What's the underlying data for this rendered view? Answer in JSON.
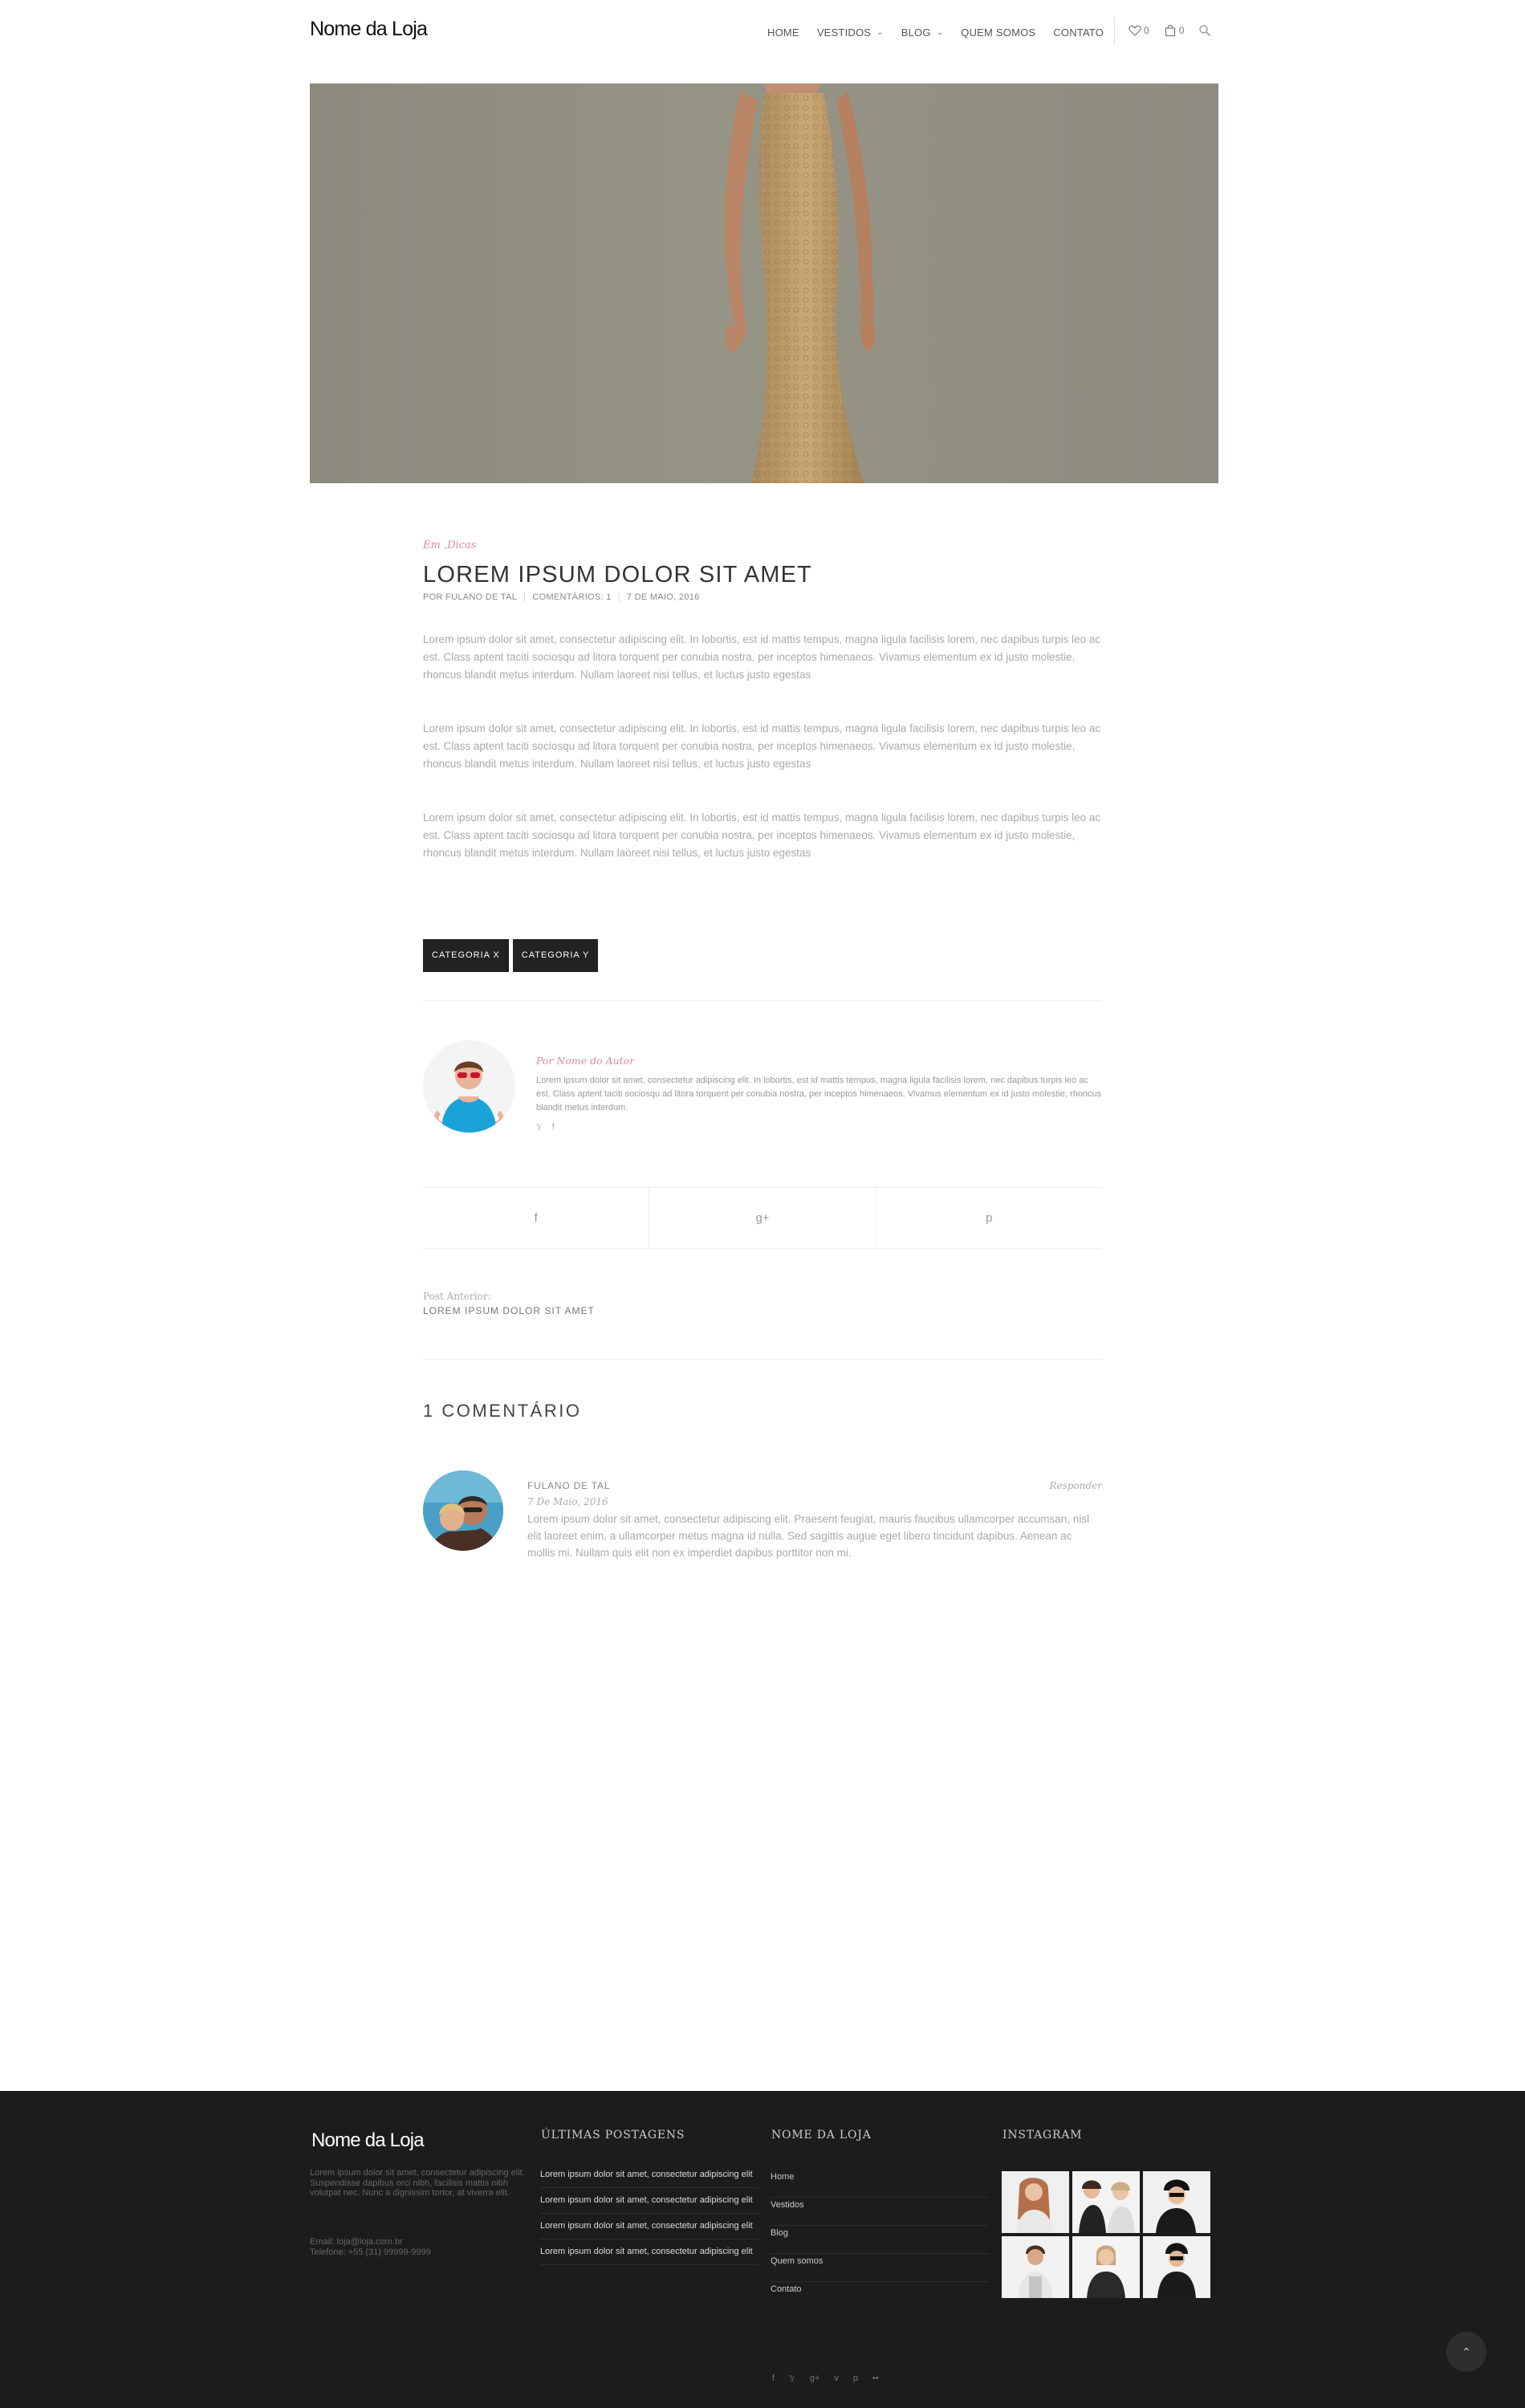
{
  "header": {
    "logo": "Nome da Loja",
    "nav": [
      {
        "label": "HOME",
        "has_dropdown": false
      },
      {
        "label": "VESTIDOS",
        "has_dropdown": true
      },
      {
        "label": "BLOG",
        "has_dropdown": true
      },
      {
        "label": "QUEM SOMOS",
        "has_dropdown": false
      },
      {
        "label": "CONTATO",
        "has_dropdown": false
      }
    ],
    "wishlist_count": "0",
    "cart_count": "0",
    "icons": [
      "heart-icon",
      "bag-icon",
      "search-icon"
    ]
  },
  "post": {
    "category_prefix": "Em ",
    "category": ",Dicas",
    "title": "LOREM IPSUM DOLOR SIT AMET",
    "author": "POR FULANO DE TAL",
    "comments": "COMENTÁRIOS: 1",
    "date": "7 DE MAIO, 2016",
    "paragraphs": [
      "Lorem ipsum dolor sit amet, consectetur adipiscing elit. In lobortis, est id mattis tempus, magna ligula facilisis lorem, nec dapibus turpis leo ac est. Class aptent taciti sociosqu ad litora torquent per conubia nostra, per inceptos himenaeos. Vivamus elementum ex id justo molestie, rhoncus blandit metus interdum. Nullam laoreet nisi tellus, et luctus justo egestas",
      "Lorem ipsum dolor sit amet, consectetur adipiscing elit. In lobortis, est id mattis tempus, magna ligula facilisis lorem, nec dapibus turpis leo ac est. Class aptent taciti sociosqu ad litora torquent per conubia nostra, per inceptos himenaeos. Vivamus elementum ex id justo molestie, rhoncus blandit metus interdum. Nullam laoreet nisi tellus, et luctus justo egestas",
      "Lorem ipsum dolor sit amet, consectetur adipiscing elit. In lobortis, est id mattis tempus, magna ligula facilisis lorem, nec dapibus turpis leo ac est. Class aptent taciti sociosqu ad litora torquent per conubia nostra, per inceptos himenaeos. Vivamus elementum ex id justo molestie, rhoncus blandit metus interdum. Nullam laoreet nisi tellus, et luctus justo egestas"
    ],
    "tags": [
      "CATEGORIA X",
      "CATEGORIA Y"
    ]
  },
  "author_box": {
    "name": "Por Nome do Autor",
    "bio": "Lorem ipsum dolor sit amet, consectetur adipiscing elit. In lobortis, est id mattis tempus, magna ligula facilisis lorem, nec dapibus turpis leo ac est. Class aptent taciti sociosqu ad litora torquent per conubia nostra, per inceptos himenaeos. Vivamus elementum ex id justo molestie, rhoncus blandit metus interdum.",
    "social": [
      "twitter-icon",
      "facebook-icon"
    ]
  },
  "share": [
    {
      "icon": "facebook-icon",
      "glyph": "f"
    },
    {
      "icon": "google-plus-icon",
      "glyph": "g+"
    },
    {
      "icon": "pinterest-icon",
      "glyph": "p"
    }
  ],
  "prev_post": {
    "label": "Post Anterior:",
    "title": "LOREM IPSUM DOLOR SIT AMET"
  },
  "comments": {
    "title": "1 COMENTÁRIO",
    "items": [
      {
        "name": "FULANO DE TAL",
        "date": "7 De Maio, 2016",
        "reply": "Responder",
        "text": "Lorem ipsum dolor sit amet, consectetur adipiscing elit. Praesent feugiat, mauris faucibus ullamcorper accumsan, nisl elit laoreet enim, a ullamcorper metus magna id nulla. Sed sagittis augue eget libero tincidunt dapibus. Aenean ac mollis mi. Nullam quis elit non ex imperdiet dapibus porttitor non mi."
      }
    ]
  },
  "footer": {
    "logo": "Nome da Loja",
    "about": "Lorem ipsum dolor sit amet, consectetur adipiscing elit. Suspendisse dapibus orci nibh, facilisis mattis nibh volutpat nec. Nunc a dignissim tortor, at viverra elit.",
    "email": "Email: loja@loja.com.br",
    "phone": "Telefone: +55 (31) 99999-9999",
    "recent_heading": "ÚLTIMAS POSTAGENS",
    "recent_posts": [
      "Lorem ipsum dolor sit amet, consectetur adipiscing elit",
      "Lorem ipsum dolor sit amet, consectetur adipiscing elit",
      "Lorem ipsum dolor sit amet, consectetur adipiscing elit",
      "Lorem ipsum dolor sit amet, consectetur adipiscing elit"
    ],
    "links_heading": "NOME DA LOJA",
    "links": [
      "Home",
      "Vestidos",
      "Blog",
      "Quem somos",
      "Contato"
    ],
    "instagram_heading": "INSTAGRAM",
    "social": [
      "facebook-icon",
      "twitter-icon",
      "google-plus-icon",
      "vimeo-icon",
      "pinterest-icon",
      "flickr-icon"
    ]
  },
  "colors": {
    "accent": "#d98aa0",
    "footer_bg": "#1c1c1c",
    "tag_bg": "#222222"
  }
}
